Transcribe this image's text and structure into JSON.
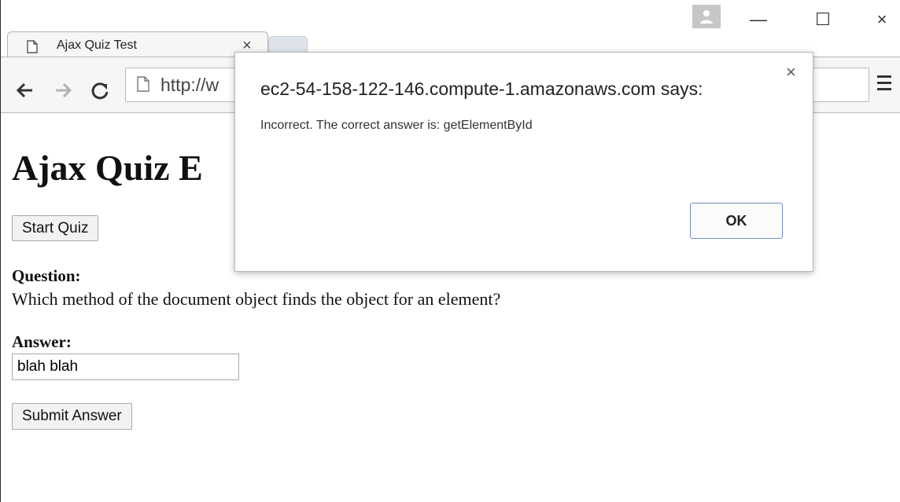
{
  "browser": {
    "tab_title": "Ajax Quiz Test",
    "tab_close": "×",
    "url": "http://w",
    "window_minimize": "—",
    "window_maximize": "☐",
    "window_close": "×"
  },
  "page": {
    "heading": "Ajax Quiz E",
    "start_button": "Start Quiz",
    "question_label": "Question:",
    "question_text": "Which method of the document object finds the object for an element?",
    "answer_label": "Answer:",
    "answer_value": "blah blah",
    "submit_button": "Submit Answer"
  },
  "dialog": {
    "title": "ec2-54-158-122-146.compute-1.amazonaws.com says:",
    "message": "Incorrect. The correct answer is: getElementById",
    "close": "×",
    "ok": "OK"
  },
  "colors": {
    "dialog_button_border": "#6f8fb7",
    "toolbar_bg": "#f6f6f6"
  },
  "icons": [
    "page-icon",
    "back-arrow-icon",
    "forward-arrow-icon",
    "reload-icon",
    "profile-icon",
    "menu-icon",
    "close-icon"
  ]
}
